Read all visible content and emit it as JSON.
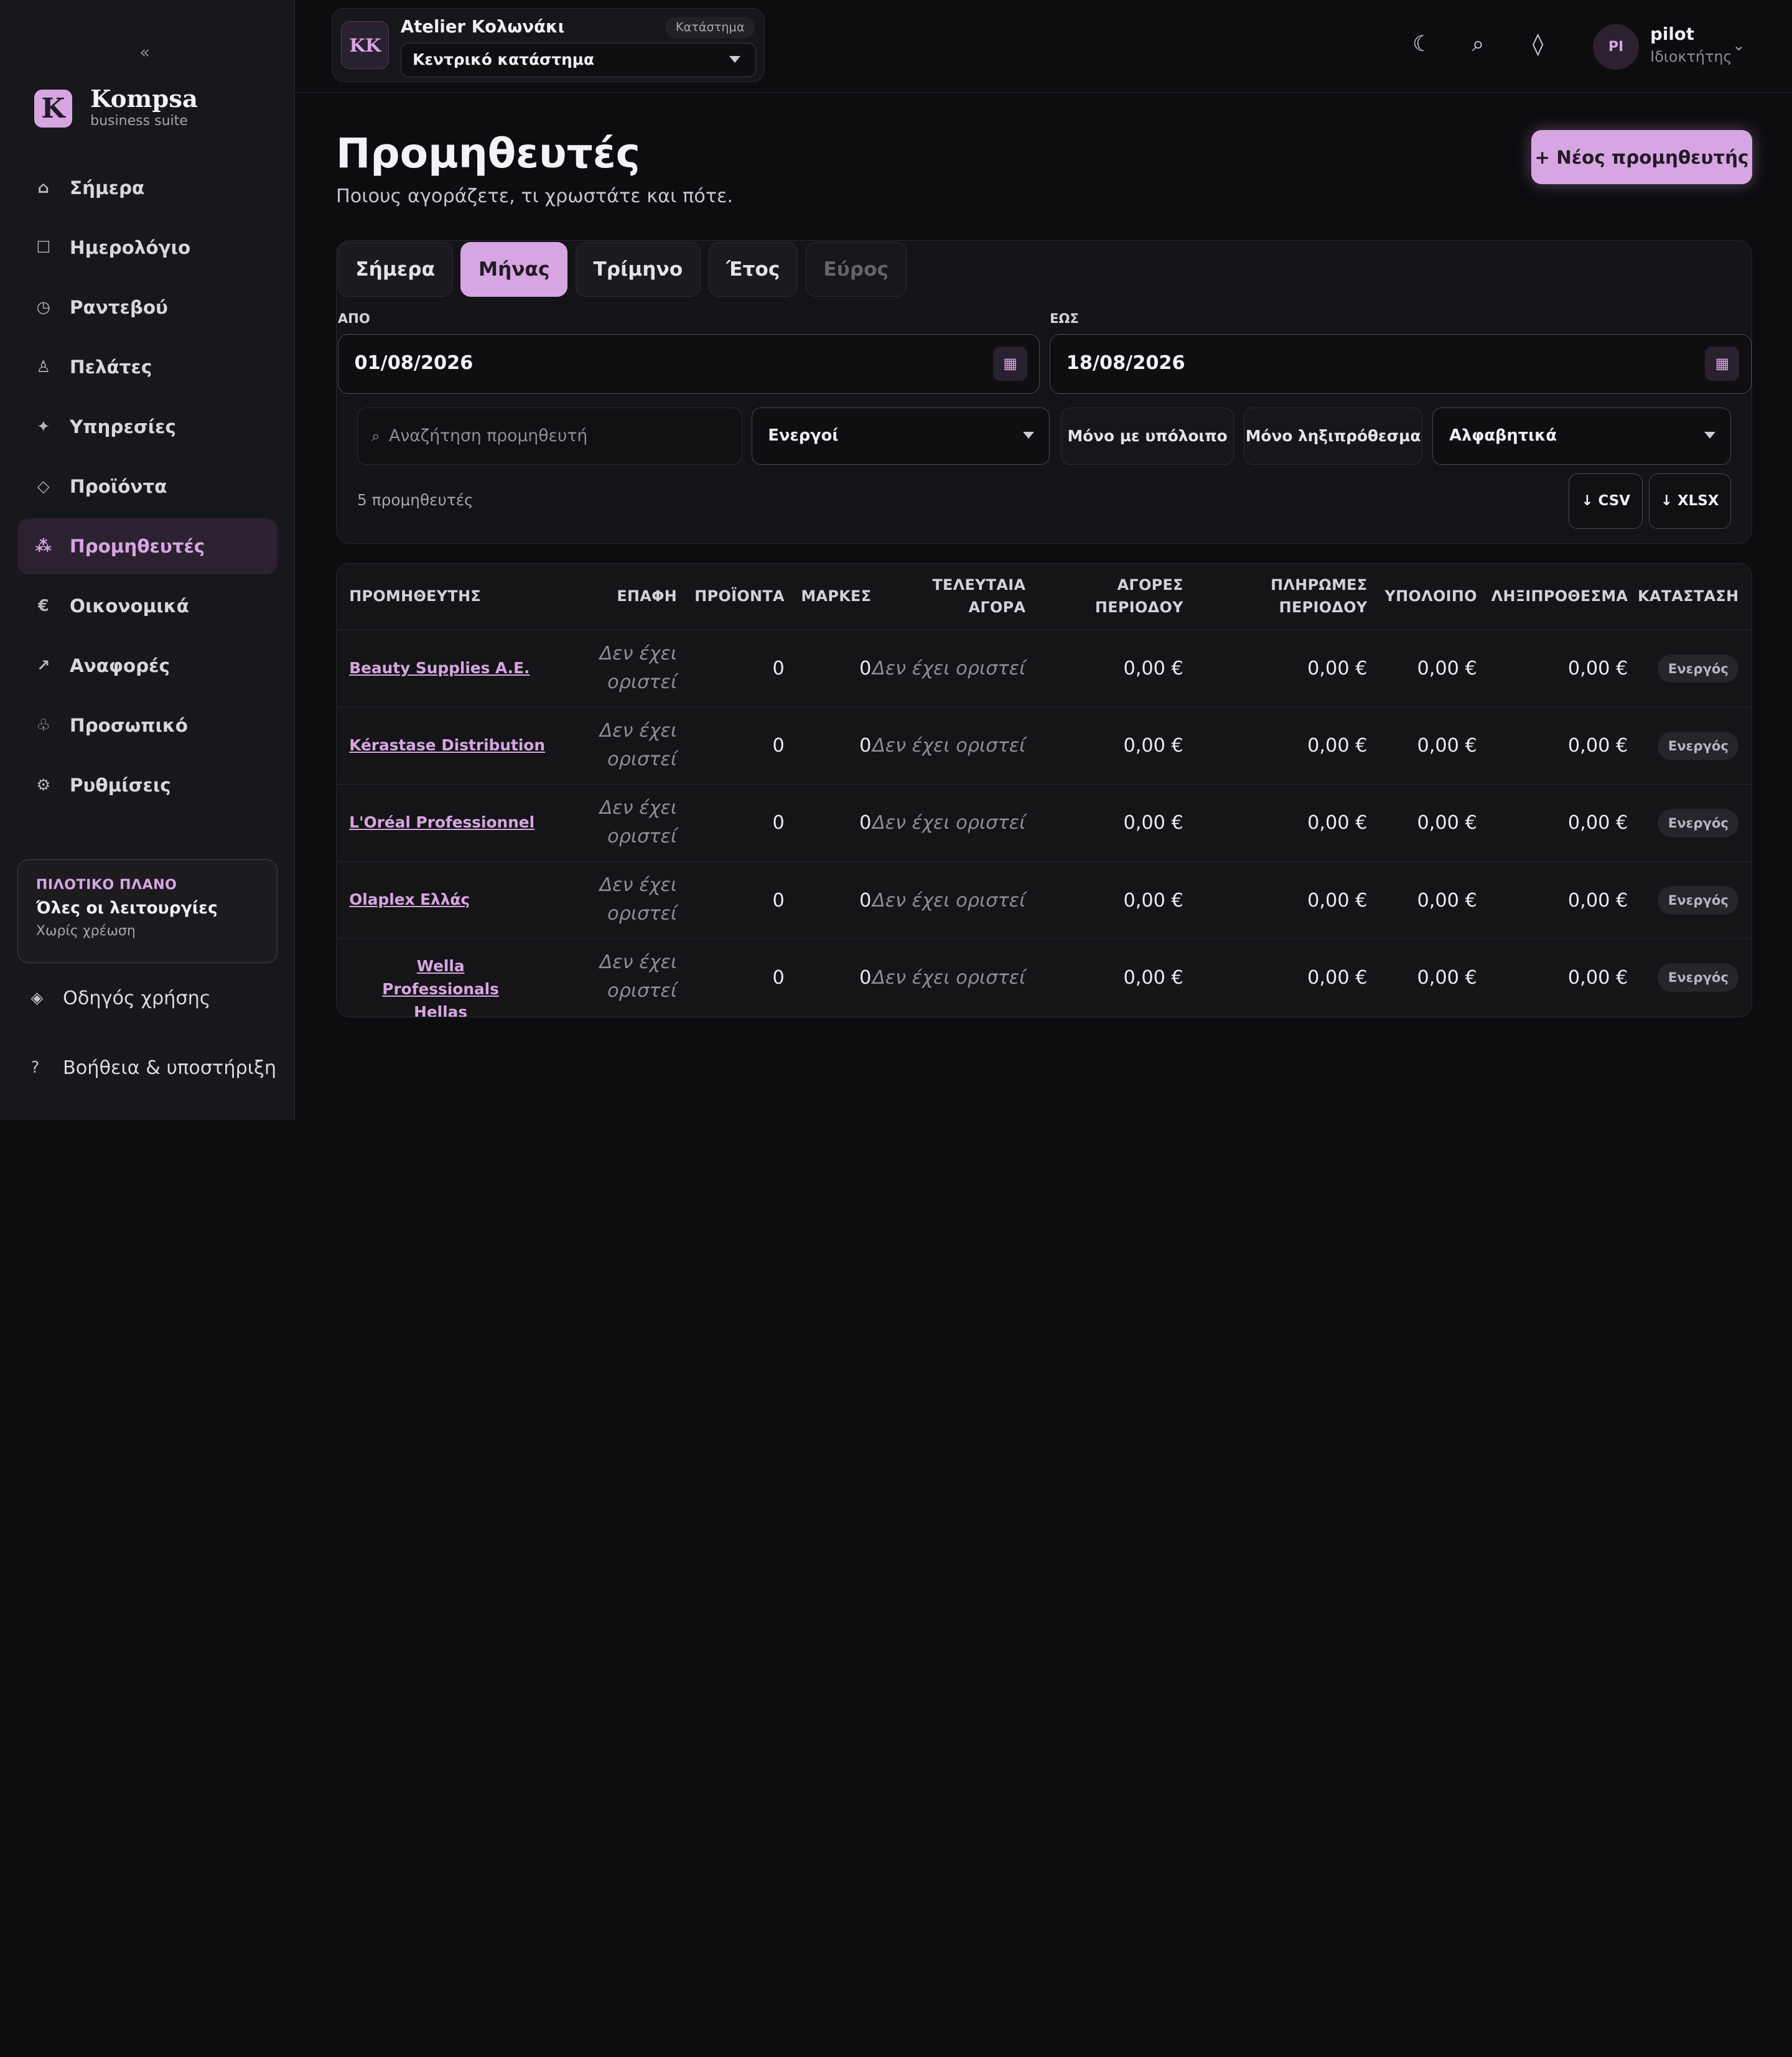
{
  "sidebar": {
    "collapse": "«",
    "brand_logo": "K",
    "brand_name": "Kompsa",
    "brand_sub": "business suite",
    "items": [
      {
        "label": "Σήμερα",
        "icon": "⌂",
        "icon_name": "home-icon"
      },
      {
        "label": "Ημερολόγιο",
        "icon": "☐",
        "icon_name": "calendar-icon"
      },
      {
        "label": "Ραντεβού",
        "icon": "◷",
        "icon_name": "clock-icon"
      },
      {
        "label": "Πελάτες",
        "icon": "♙",
        "icon_name": "person-icon"
      },
      {
        "label": "Υπηρεσίες",
        "icon": "✦",
        "icon_name": "sparkle-icon"
      },
      {
        "label": "Προϊόντα",
        "icon": "◇",
        "icon_name": "diamond-icon"
      },
      {
        "label": "Προμηθευτές",
        "icon": "⁂",
        "icon_name": "suppliers-icon",
        "active": true
      },
      {
        "label": "Οικονομικά",
        "icon": "€",
        "icon_name": "euro-icon"
      },
      {
        "label": "Αναφορές",
        "icon": "↗",
        "icon_name": "trend-icon"
      },
      {
        "label": "Προσωπικό",
        "icon": "♧",
        "icon_name": "staff-icon"
      },
      {
        "label": "Ρυθμίσεις",
        "icon": "⚙",
        "icon_name": "gear-icon"
      }
    ],
    "plan": {
      "kicker": "ΠΙΛΟΤΙΚΟ ΠΛΑΝΟ",
      "title": "Όλες οι λειτουργίες",
      "sub": "Χωρίς χρέωση"
    },
    "guide": {
      "label": "Οδηγός χρήσης",
      "icon": "◈"
    },
    "help": {
      "label": "Βοήθεια & υποστήριξη",
      "icon": "?"
    }
  },
  "topbar": {
    "store_initials": "KK",
    "store_name": "Atelier Κολωνάκι",
    "store_badge": "Κατάστημα",
    "branch": "Κεντρικό κατάστημα",
    "icons": {
      "theme": "☾",
      "search": "⌕",
      "notify": "◊"
    },
    "user_initials": "PI",
    "user_name": "pilot",
    "user_role": "Ιδιοκτήτης",
    "user_chevron": "⌄"
  },
  "main": {
    "title": "Προμηθευτές",
    "subtitle": "Ποιους αγοράζετε, τι χρωστάτε και πότε.",
    "new_button": "+ Νέος προμηθευτής",
    "tabs": [
      {
        "label": "Σήμερα"
      },
      {
        "label": "Μήνας",
        "active": true
      },
      {
        "label": "Τρίμηνο"
      },
      {
        "label": "Έτος"
      },
      {
        "label": "Εύρος",
        "disabled": true
      }
    ],
    "from_label": "ΑΠΟ",
    "from_value": "01/08/2026",
    "to_label": "ΕΩΣ",
    "to_value": "18/08/2026",
    "cal_icon": "▦",
    "search_icon": "⌕",
    "search_placeholder": "Αναζήτηση προμηθευτή",
    "status_select": "Ενεργοί",
    "balance_chip": "Μόνο με υπόλοιπο",
    "overdue_chip": "Μόνο ληξιπρόθεσμα",
    "sort_select": "Αλφαβητικά",
    "count": "5 προμηθευτές",
    "csv": "↓ CSV",
    "xlsx": "↓ XLSX"
  },
  "table": {
    "headers": {
      "supplier": "ΠΡΟΜΗΘΕΥΤΗΣ",
      "contact": "ΕΠΑΦΗ",
      "products": "ΠΡΟΪΟΝΤΑ",
      "brands": "ΜΑΡΚΕΣ",
      "last_purchase_1": "ΤΕΛΕΥΤΑΙΑ",
      "last_purchase_2": "ΑΓΟΡΑ",
      "purchases_1": "ΑΓΟΡΕΣ",
      "purchases_2": "ΠΕΡΙΟΔΟΥ",
      "payments_1": "ΠΛΗΡΩΜΕΣ",
      "payments_2": "ΠΕΡΙΟΔΟΥ",
      "balance": "ΥΠΟΛΟΙΠΟ",
      "overdue": "ΛΗΞΙΠΡΟΘΕΣΜΑ",
      "status": "ΚΑΤΑΣΤΑΣΗ"
    },
    "rows": [
      {
        "name": "Beauty Supplies A.E.",
        "contact_1": "Δεν έχει",
        "contact_2": "οριστεί",
        "products": "0",
        "brands": "0",
        "last": "Δεν έχει οριστεί",
        "purchases": "0,00 €",
        "payments": "0,00 €",
        "balance": "0,00 €",
        "overdue": "0,00 €",
        "status": "Ενεργός"
      },
      {
        "name": "Kérastase Distribution",
        "contact_1": "Δεν έχει",
        "contact_2": "οριστεί",
        "products": "0",
        "brands": "0",
        "last": "Δεν έχει οριστεί",
        "purchases": "0,00 €",
        "payments": "0,00 €",
        "balance": "0,00 €",
        "overdue": "0,00 €",
        "status": "Ενεργός"
      },
      {
        "name": "L'Oréal Professionnel",
        "contact_1": "Δεν έχει",
        "contact_2": "οριστεί",
        "products": "0",
        "brands": "0",
        "last": "Δεν έχει οριστεί",
        "purchases": "0,00 €",
        "payments": "0,00 €",
        "balance": "0,00 €",
        "overdue": "0,00 €",
        "status": "Ενεργός"
      },
      {
        "name": "Olaplex Ελλάς",
        "contact_1": "Δεν έχει",
        "contact_2": "οριστεί",
        "products": "0",
        "brands": "0",
        "last": "Δεν έχει οριστεί",
        "purchases": "0,00 €",
        "payments": "0,00 €",
        "balance": "0,00 €",
        "overdue": "0,00 €",
        "status": "Ενεργός"
      },
      {
        "name": "Wella Professionals Hellas",
        "contact_1": "Δεν έχει",
        "contact_2": "οριστεί",
        "products": "0",
        "brands": "0",
        "last": "Δεν έχει οριστεί",
        "purchases": "0,00 €",
        "payments": "0,00 €",
        "balance": "0,00 €",
        "overdue": "0,00 €",
        "status": "Ενεργός"
      }
    ]
  },
  "colors": {
    "accent": "#d7a6e2",
    "background": "#0d0c0f",
    "sidebar": "#18171b"
  }
}
